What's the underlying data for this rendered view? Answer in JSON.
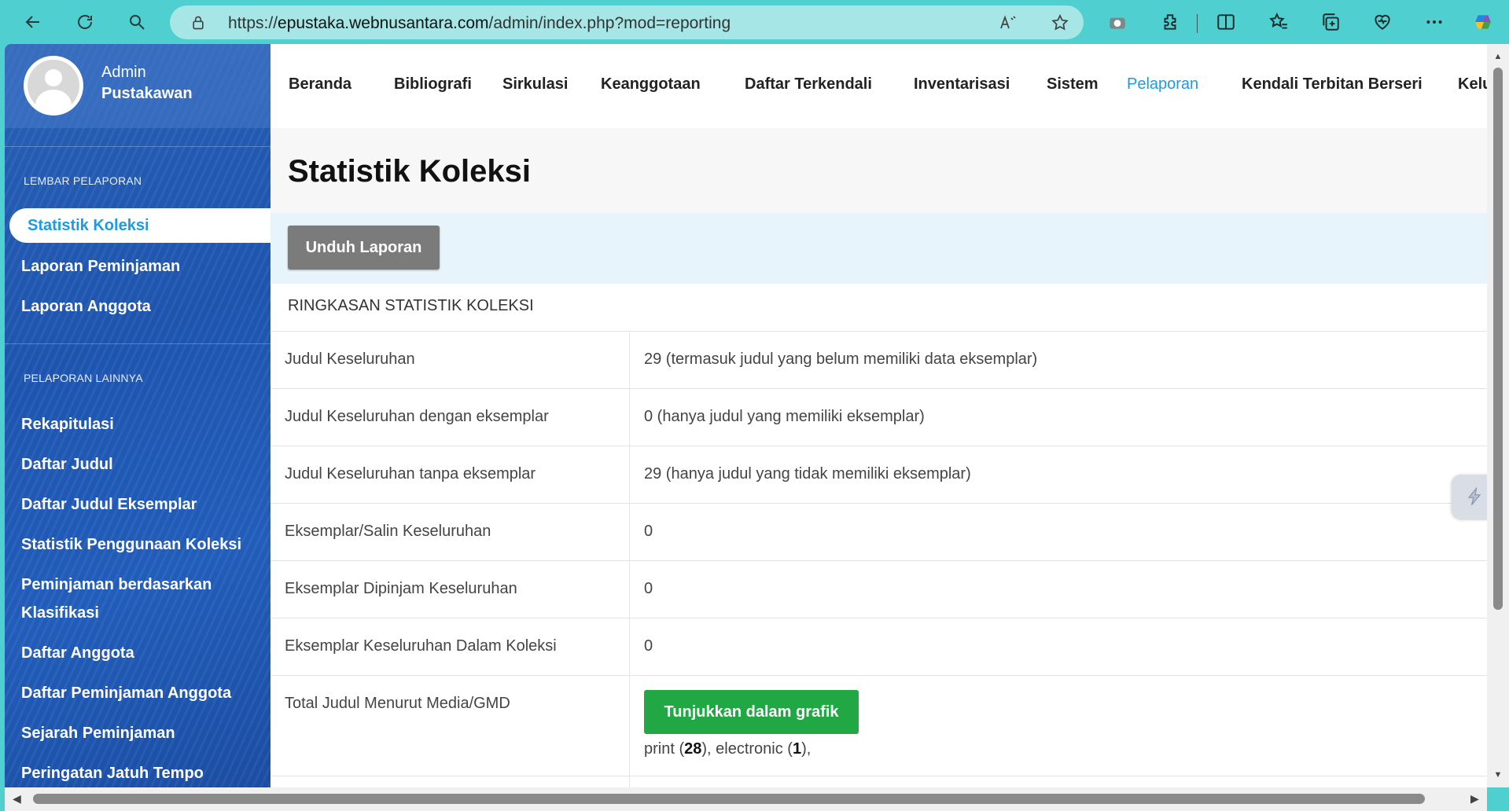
{
  "browser": {
    "url_prefix": "https://",
    "url_host": "epustaka.webnusantara.com",
    "url_path": "/admin/index.php?mod=reporting"
  },
  "user": {
    "role": "Admin",
    "name": "Pustakawan"
  },
  "sidebar": {
    "section1_heading": "LEMBAR PELAPORAN",
    "section1_items": [
      "Statistik Koleksi",
      "Laporan Peminjaman",
      "Laporan Anggota"
    ],
    "section2_heading": "PELAPORAN LAINNYA",
    "section2_items": [
      "Rekapitulasi",
      "Daftar Judul",
      "Daftar Judul Eksemplar",
      "Statistik Penggunaan Koleksi",
      "Peminjaman berdasarkan",
      "Klasifikasi",
      "Daftar Anggota",
      "Daftar Peminjaman Anggota",
      "Sejarah Peminjaman",
      "Peringatan Jatuh Tempo"
    ]
  },
  "topnav": [
    "Beranda",
    "Bibliografi",
    "Sirkulasi",
    "Keanggotaan",
    "Daftar Terkendali",
    "Inventarisasi",
    "Sistem",
    "Pelaporan",
    "Kendali Terbitan Berseri",
    "Kelu"
  ],
  "main": {
    "title": "Statistik Koleksi",
    "download_button": "Unduh Laporan",
    "summary_heading": "RINGKASAN STATISTIK KOLEKSI",
    "rows": [
      {
        "label": "Judul Keseluruhan",
        "value": "29 (termasuk judul yang belum memiliki data eksemplar)"
      },
      {
        "label": "Judul Keseluruhan dengan eksemplar",
        "value": "0 (hanya judul yang memiliki eksemplar)"
      },
      {
        "label": "Judul Keseluruhan tanpa eksemplar",
        "value": "29 (hanya judul yang tidak memiliki eksemplar)"
      },
      {
        "label": "Eksemplar/Salin Keseluruhan",
        "value": "0"
      },
      {
        "label": "Eksemplar Dipinjam Keseluruhan",
        "value": "0"
      },
      {
        "label": "Eksemplar Keseluruhan Dalam Koleksi",
        "value": "0"
      },
      {
        "label": "Total Judul Menurut Media/GMD",
        "value": ""
      }
    ],
    "chart_button": "Tunjukkan dalam grafik",
    "gmd": {
      "print_label": "print (",
      "print_count": "28",
      "electronic_label": "), electronic (",
      "electronic_count": "1",
      "suffix": "),"
    }
  },
  "colors": {
    "browser_bg": "#4fcfcf",
    "sidebar_bg": "#2360bf",
    "accent": "#1e9be0",
    "download_btn": "#7b7b7b",
    "chart_btn": "#22a745"
  }
}
